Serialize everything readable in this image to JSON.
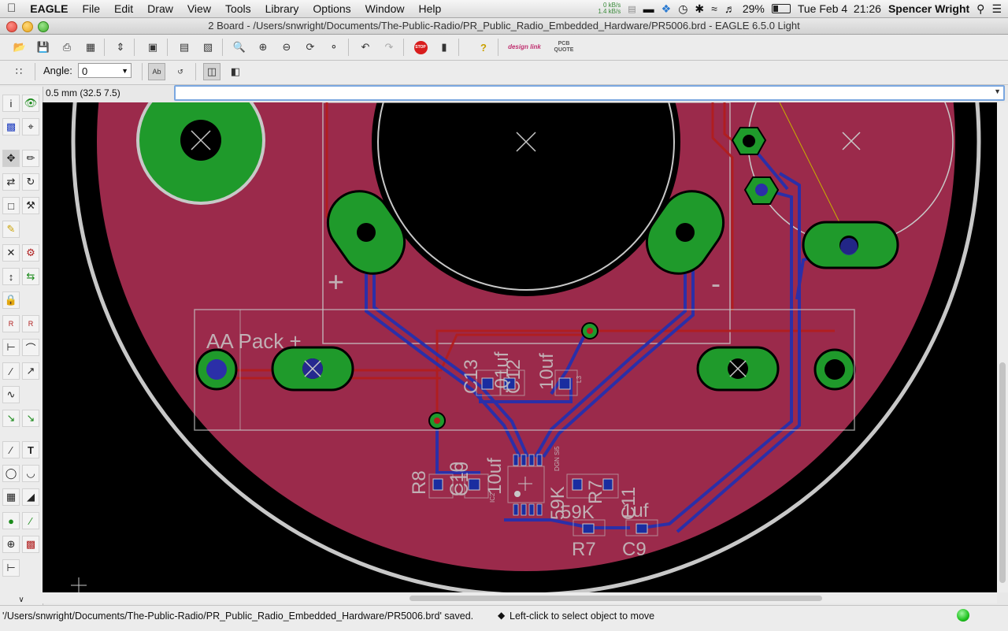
{
  "menubar": {
    "apple_icon": "apple-icon",
    "app_name": "EAGLE",
    "items": [
      "File",
      "Edit",
      "Draw",
      "View",
      "Tools",
      "Library",
      "Options",
      "Window",
      "Help"
    ],
    "net_up": "0 kB/s",
    "net_down": "1.4 kB/s",
    "battery": "29%",
    "datetime": "Tue Feb 4  21:26",
    "user": "Spencer Wright"
  },
  "window": {
    "title": "2 Board - /Users/snwright/Documents/The-Public-Radio/PR_Public_Radio_Embedded_Hardware/PR5006.brd - EAGLE 6.5.0 Light"
  },
  "toolbar": {
    "stop_label": "STOP",
    "designlink_label": "design link",
    "pcbquote_label": "PCB QUOTE"
  },
  "params": {
    "angle_label": "Angle:",
    "angle_value": "0"
  },
  "coordinate_display": "0.5 mm (32.5 7.5)",
  "command_line": {
    "value": ""
  },
  "board": {
    "labels": {
      "plus": "+",
      "minus": "-",
      "aa_pack": "AA Pack +",
      "c13": "C13",
      "c12_value": ".01uf",
      "c12": "C12",
      "c10_value": "10uf",
      "r8": "R8",
      "c10": "C10",
      "c10b": "C10",
      "val_10uf_b": "10uf",
      "ic_value": "DGN Si5",
      "r7_value": "59K",
      "r7_value_b": "59K",
      "r7": "R7",
      "c11": "C11",
      "c9_value": "1uf",
      "c9": "C9",
      "l3": "L3",
      "ic_small": "IC2"
    },
    "colors": {
      "board": "#9b2a4b",
      "top_trace": "#b21e1e",
      "bottom_trace": "#2b2fa8",
      "pad": "#1f9a2b",
      "outline": "#c8c8c8"
    }
  },
  "status": {
    "saved_message": "'/Users/snwright/Documents/The-Public-Radio/PR_Public_Radio_Embedded_Hardware/PR5006.brd' saved.",
    "hint": "Left-click to select object to move",
    "led_color": "#1ec21e"
  }
}
